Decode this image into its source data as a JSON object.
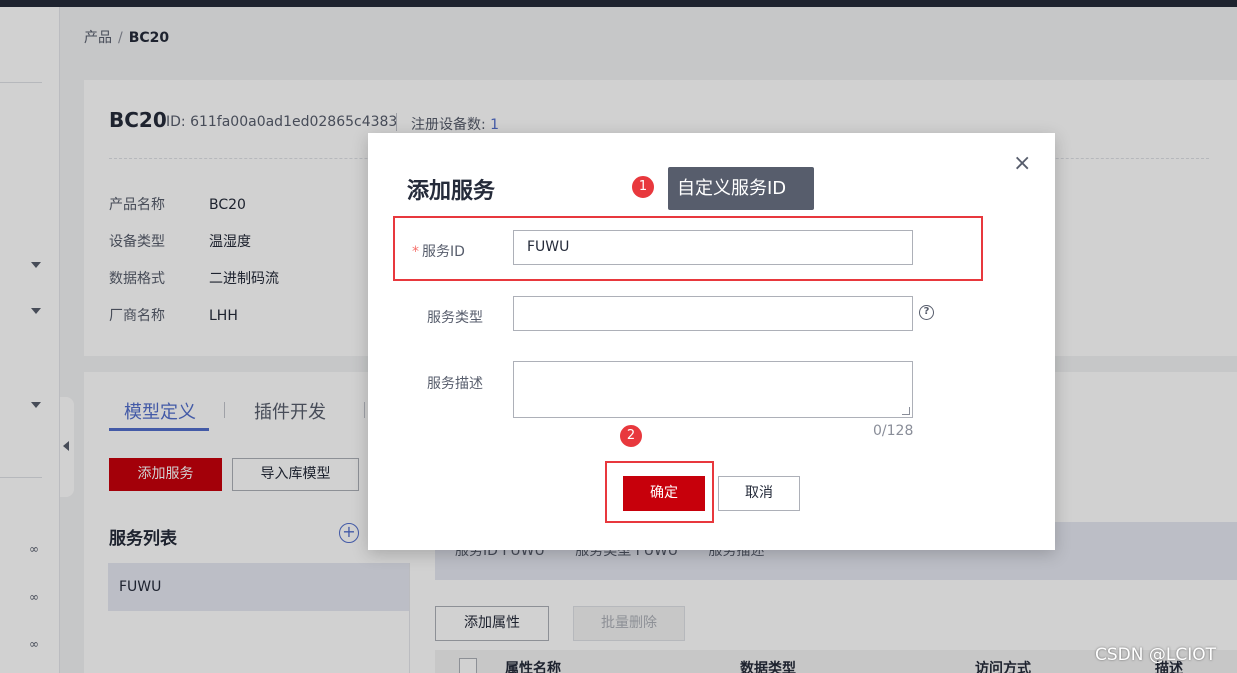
{
  "breadcrumb": {
    "parent": "产品",
    "separator": "/",
    "current": "BC20"
  },
  "product": {
    "title": "BC20",
    "id_text": "ID: 611fa00a0ad1ed02865c4383",
    "device_count_label": "注册设备数:",
    "device_count": "1",
    "fields": [
      {
        "label": "产品名称",
        "value": "BC20"
      },
      {
        "label": "设备类型",
        "value": "温湿度"
      },
      {
        "label": "数据格式",
        "value": "二进制码流"
      },
      {
        "label": "厂商名称",
        "value": "LHH"
      }
    ]
  },
  "tabs": [
    {
      "label": "模型定义",
      "active": true
    },
    {
      "label": "插件开发",
      "active": false
    }
  ],
  "toolbar": {
    "add_service": "添加服务",
    "import_model": "导入库模型"
  },
  "service_list": {
    "title": "服务列表",
    "add_icon": "+",
    "items": [
      "FUWU"
    ]
  },
  "service_banner": {
    "id_text": "服务ID  FUWU",
    "type_text": "服务类型  FUWU",
    "desc_text": "服务描述"
  },
  "property_toolbar": {
    "add_property": "添加属性",
    "batch_delete": "批量删除"
  },
  "property_table": {
    "headers": [
      "属性名称",
      "数据类型",
      "访问方式",
      "描述"
    ]
  },
  "modal": {
    "title": "添加服务",
    "close_icon": "×",
    "service_id": {
      "label": "服务ID",
      "required_mark": "*",
      "value": "FUWU"
    },
    "service_type": {
      "label": "服务类型",
      "value": "",
      "help_icon": "?"
    },
    "service_desc": {
      "label": "服务描述",
      "value": "",
      "counter": "0/128"
    },
    "confirm": "确定",
    "cancel": "取消"
  },
  "annotations": {
    "badge1": "1",
    "tip1": "自定义服务ID",
    "badge2": "2"
  },
  "watermark": "CSDN @LCIOT",
  "colors": {
    "primary": "#c7000b",
    "accent": "#526ecc",
    "annotation": "#e8383d"
  }
}
